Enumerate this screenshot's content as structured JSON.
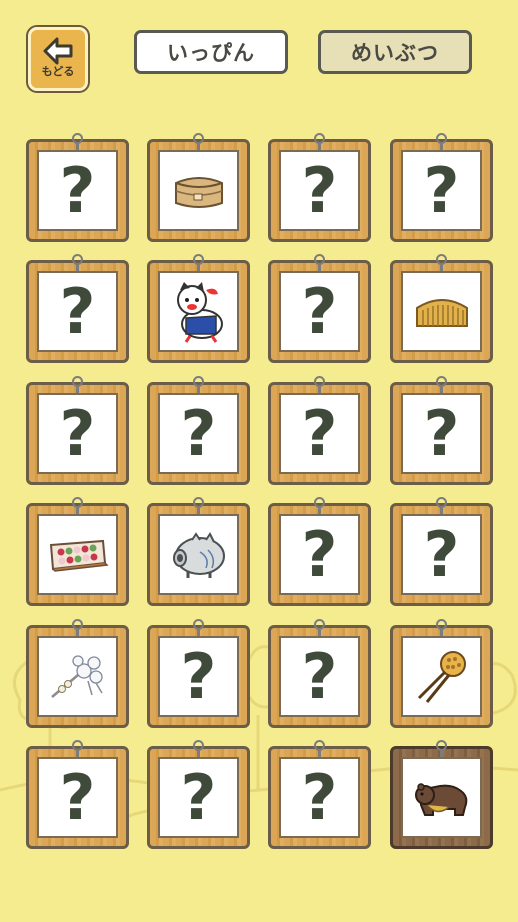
{
  "header": {
    "back_label": "もどる",
    "tabs": [
      {
        "label": "いっぴん",
        "active": true
      },
      {
        "label": "めいぶつ",
        "active": false
      }
    ]
  },
  "grid": {
    "unknown_symbol": "?",
    "cards": [
      {
        "state": "unknown"
      },
      {
        "state": "found",
        "icon": "wooden-lunchbox-icon"
      },
      {
        "state": "unknown"
      },
      {
        "state": "unknown"
      },
      {
        "state": "unknown"
      },
      {
        "state": "found",
        "icon": "inu-hariko-dog-toy-icon"
      },
      {
        "state": "unknown"
      },
      {
        "state": "found",
        "icon": "wooden-comb-icon"
      },
      {
        "state": "unknown"
      },
      {
        "state": "unknown"
      },
      {
        "state": "unknown"
      },
      {
        "state": "unknown"
      },
      {
        "state": "found",
        "icon": "sweets-box-icon"
      },
      {
        "state": "found",
        "icon": "pig-incense-holder-icon"
      },
      {
        "state": "unknown"
      },
      {
        "state": "unknown"
      },
      {
        "state": "found",
        "icon": "flower-hairpin-icon"
      },
      {
        "state": "unknown"
      },
      {
        "state": "unknown"
      },
      {
        "state": "found",
        "icon": "tortoiseshell-hairpin-icon"
      },
      {
        "state": "unknown"
      },
      {
        "state": "unknown"
      },
      {
        "state": "unknown"
      },
      {
        "state": "found",
        "icon": "bear-carving-icon",
        "selected": true
      }
    ]
  },
  "colors": {
    "background": "#f5ec8f",
    "frame_wood": "#dba756",
    "frame_selected": "#8c6a4a",
    "question_mark": "#3f4a3b"
  }
}
